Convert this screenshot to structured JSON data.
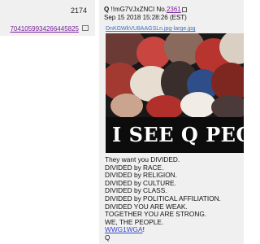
{
  "left_post": {
    "number": "2174",
    "link_text": "7041059934266445825"
  },
  "post": {
    "author": "Q",
    "tripcode": "!!mG7VJxZNCI",
    "number_label": "No.",
    "number": "2361",
    "date": "Sep 15 2018 15:28:26 (EST)",
    "filename": "DnKGWkVU8AAGSLn.jpg-large.jpg",
    "image_caption": "I SEE Q PEO",
    "lines": [
      "They want you DIVIDED.",
      "DIVIDED by RACE.",
      "DIVIDED by RELIGION.",
      "DIVIDED by CULTURE.",
      "DIVIDED by CLASS.",
      "DIVIDED by POLITICAL AFFILIATION.",
      "DIVIDED YOU ARE WEAK.",
      "TOGETHER YOU ARE STRONG.",
      "WE, THE PEOPLE."
    ],
    "hashtag": "WWG1WGA",
    "hashtag_suffix": "!",
    "signature": "Q"
  }
}
